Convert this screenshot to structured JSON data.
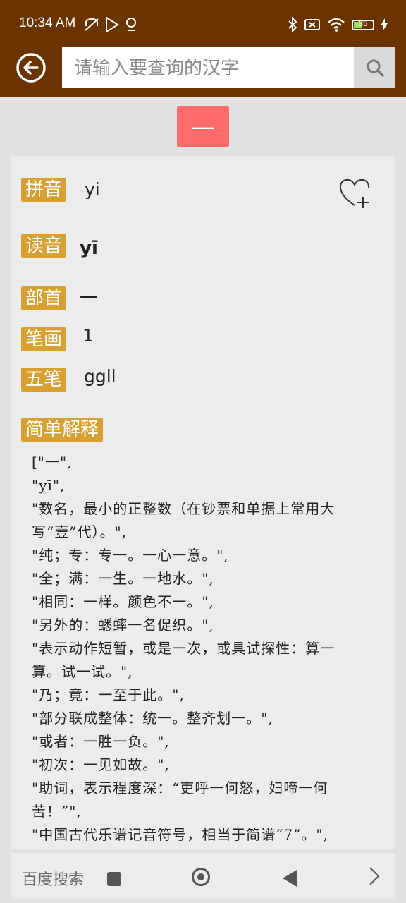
{
  "status_bar": {
    "time": "10:34 AM",
    "battery": "35",
    "left_icons": [
      "mute-icon",
      "play-store-icon",
      "location-icon"
    ],
    "right_icons": [
      "bluetooth-icon",
      "no-sim-icon",
      "wifi-icon",
      "battery-icon",
      "charging-icon"
    ]
  },
  "header": {
    "search_placeholder": "请输入要查询的汉字",
    "back_icon": "back-arrow-icon",
    "search_icon": "search-icon",
    "color": "#6b3300"
  },
  "character": {
    "glyph": "—",
    "color": "#ff6b6b"
  },
  "details": {
    "pinyin_label": "拼音",
    "pinyin_value": "yi",
    "reading_label": "读音",
    "reading_value": "yī",
    "radical_label": "部首",
    "radical_value": "一",
    "strokes_label": "笔画",
    "strokes_value": "1",
    "wubi_label": "五笔",
    "wubi_value": "ggll",
    "explain_label": "简单解释",
    "tag_color": "#d8a030"
  },
  "explanation_lines": [
    "[\"一\",",
    "\"yī\",",
    "\"数名，最小的正整数（在钞票和单据上常用大",
    "写“壹”代）。\",",
    "\"纯；专：专一。一心一意。\",",
    "\"全；满：一生。一地水。\",",
    "\"相同：一样。颜色不一。\",",
    "\"另外的：蟋蟀一名促织。\",",
    "\"表示动作短暂，或是一次，或具试探性：算一",
    "算。试一试。\",",
    "\"乃；竟：一至于此。\",",
    "\"部分联成整体：统一。整齐划一。\",",
    "\"或者：一胜一负。\",",
    "\"初次：一见如故。\",",
    "\"助词，表示程度深：“吏呼一何怒，妇啼一何",
    "苦！”\",",
    "\"中国古代乐谱记音符号，相当于简谱“7”。\","
  ],
  "bottom_bar": {
    "label": "百度搜索"
  }
}
